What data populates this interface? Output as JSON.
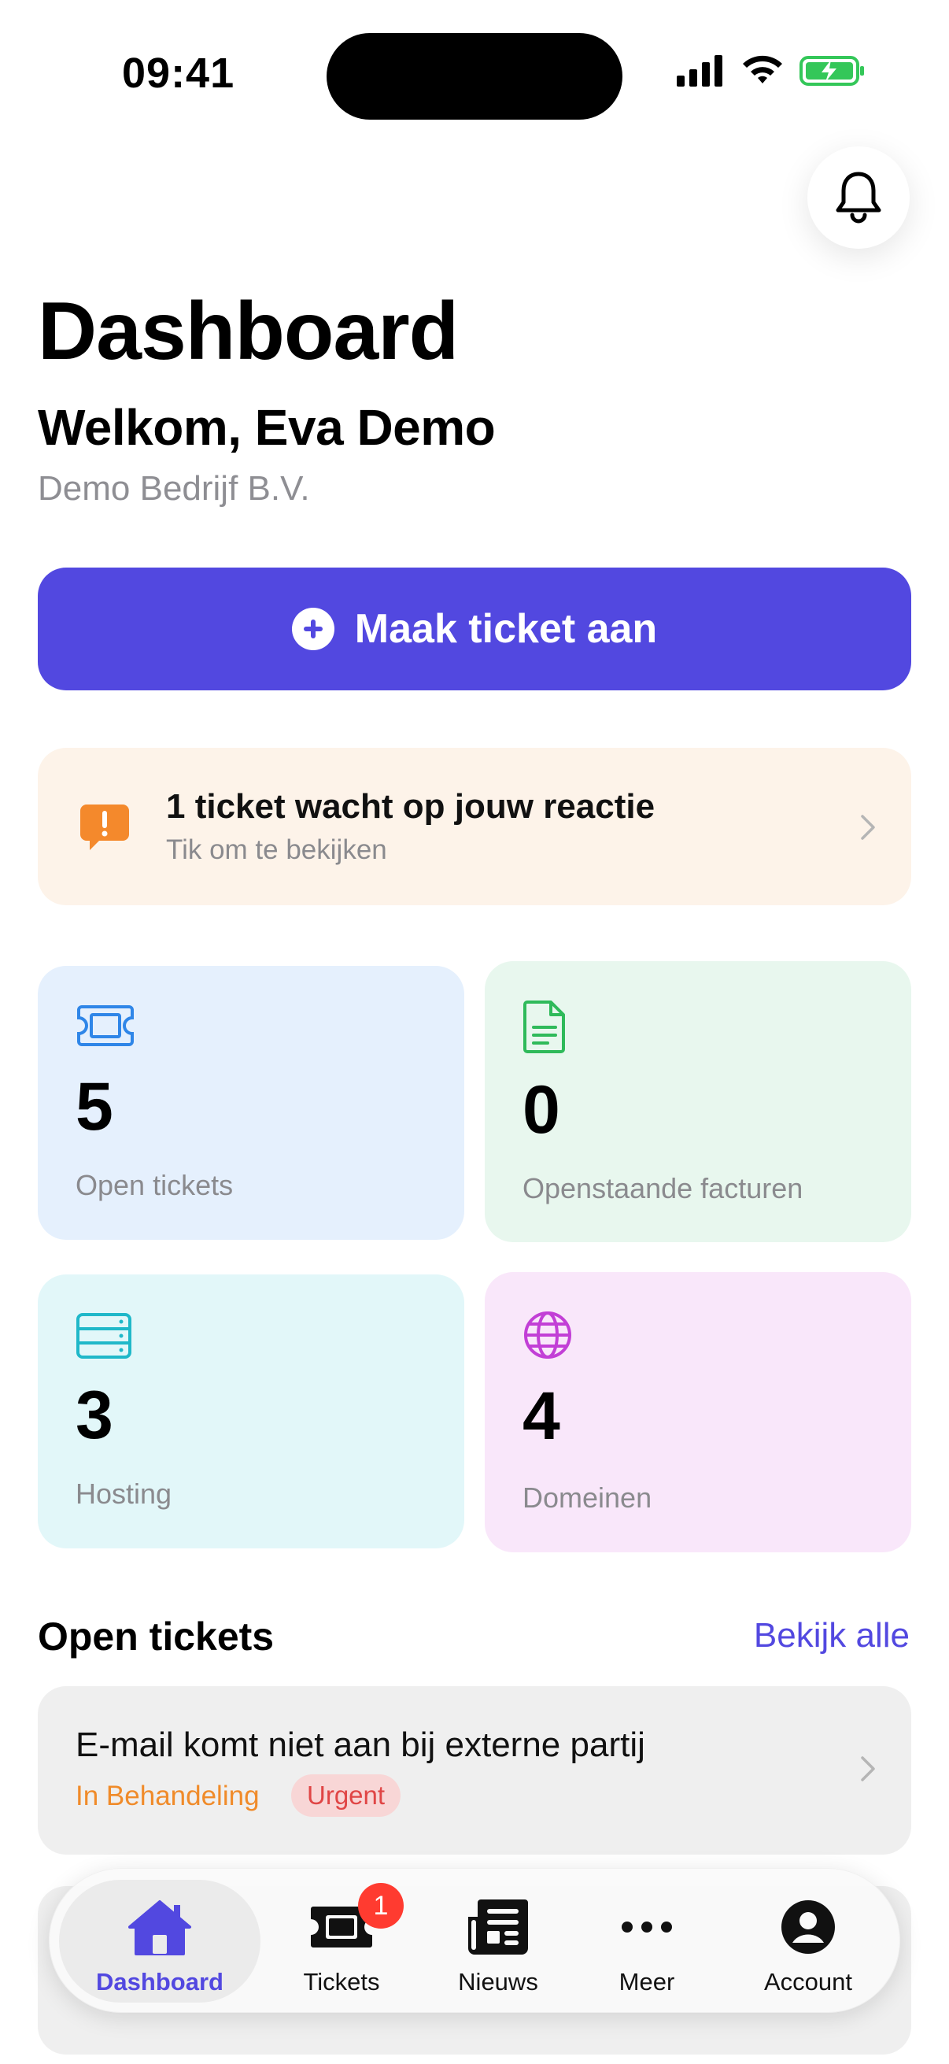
{
  "status_bar": {
    "time": "09:41"
  },
  "header": {
    "title": "Dashboard",
    "welcome": "Welkom, Eva Demo",
    "company": "Demo Bedrijf B.V."
  },
  "actions": {
    "create_ticket_label": "Maak ticket aan"
  },
  "alert": {
    "title": "1 ticket wacht op jouw reactie",
    "subtitle": "Tik om te bekijken"
  },
  "stats": {
    "open_tickets": {
      "value": "5",
      "label": "Open tickets"
    },
    "invoices": {
      "value": "0",
      "label": "Openstaande facturen"
    },
    "hosting": {
      "value": "3",
      "label": "Hosting"
    },
    "domains": {
      "value": "4",
      "label": "Domeinen"
    }
  },
  "open_tickets_section": {
    "title": "Open tickets",
    "see_all": "Bekijk alle",
    "tickets": [
      {
        "title": "E-mail komt niet aan bij externe partij",
        "status": "In Behandeling",
        "priority": "Urgent"
      }
    ]
  },
  "tab_bar": {
    "items": [
      {
        "label": "Dashboard",
        "icon": "home-icon",
        "active": true
      },
      {
        "label": "Tickets",
        "icon": "ticket-icon",
        "badge": "1"
      },
      {
        "label": "Nieuws",
        "icon": "newspaper-icon"
      },
      {
        "label": "Meer",
        "icon": "more-icon"
      },
      {
        "label": "Account",
        "icon": "account-icon"
      }
    ]
  },
  "colors": {
    "accent": "#5248e0",
    "warning": "#f08b2a",
    "danger": "#e04646"
  }
}
